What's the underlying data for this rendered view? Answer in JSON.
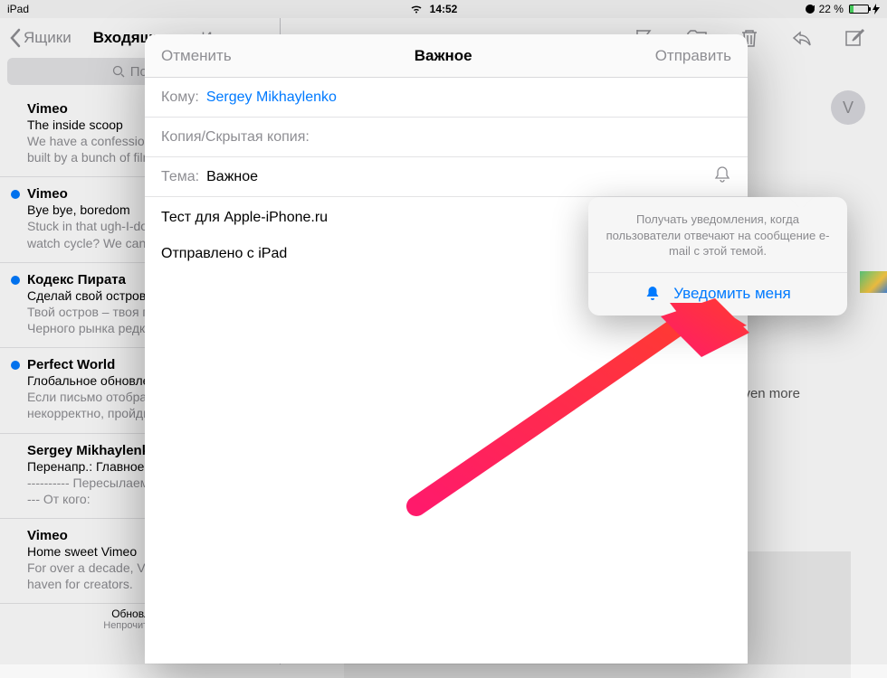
{
  "status": {
    "device": "iPad",
    "time": "14:52",
    "battery_pct": "22 %"
  },
  "nav": {
    "back": "Ящики",
    "title": "Входящие",
    "edit": "Изменить"
  },
  "search": {
    "placeholder": "Поиск"
  },
  "messages": [
    {
      "unread": false,
      "sender": "Vimeo",
      "subject": "The inside scoop",
      "preview": "We have a confession to make: we were built by a bunch of filmmakers."
    },
    {
      "unread": true,
      "sender": "Vimeo",
      "subject": "Bye bye, boredom",
      "preview": "Stuck in that ugh-I-don't-know-what-to-watch cycle? We can help."
    },
    {
      "unread": true,
      "sender": "Кодекс Пирата",
      "subject": "Сделай свой остров лучше!",
      "preview": "Твой остров – твоя гордость! Товары с Черного рынка редки и ценны."
    },
    {
      "unread": true,
      "sender": "Perfect World",
      "subject": "Глобальное обновление",
      "preview": "Если письмо отображается некорректно, пройдите по ссылке."
    },
    {
      "unread": false,
      "sender": "Sergey Mikhaylenko",
      "subject": "Перенапр.: Главное",
      "preview": "---------- Пересылаемое сообщение ---------- От кого:"
    },
    {
      "unread": false,
      "sender": "Vimeo",
      "subject": "Home sweet Vimeo",
      "preview": "For over a decade, Vimeo has been a safe haven for creators."
    }
  ],
  "sync": {
    "line1": "Обновлено",
    "line2": "Непрочитанных"
  },
  "reader": {
    "avatar_letter": "V",
    "body": "we love to soak up the sunshine. It's also why we want to give you even more reasons to open the doors just long"
  },
  "compose": {
    "cancel": "Отменить",
    "title": "Важное",
    "send": "Отправить",
    "to_label": "Кому:",
    "to_value": "Sergey Mikhaylenko",
    "cc_label": "Копия/Скрытая копия:",
    "subject_label": "Тема:",
    "subject_value": "Важное",
    "body_line1": "Тест для Apple-iPhone.ru",
    "body_line2": "Отправлено с iPad"
  },
  "popover": {
    "text": "Получать уведомления, когда пользователи отвечают на сообщение e-mail с этой темой.",
    "action": "Уведомить меня"
  }
}
